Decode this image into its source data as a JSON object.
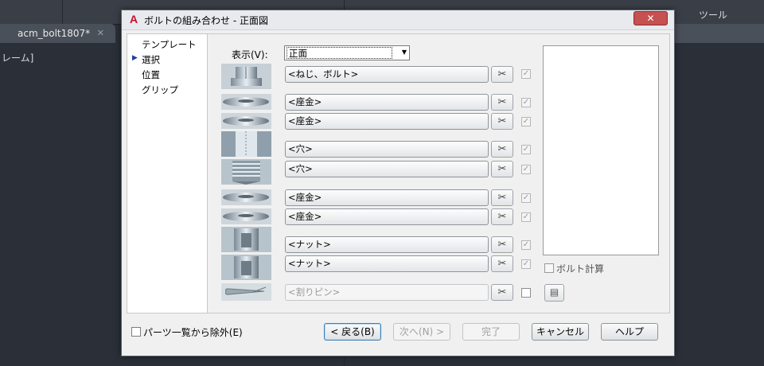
{
  "background_app": {
    "document_tab": "acm_bolt1807*",
    "tab_close": "✕",
    "left_fragment": "レーム]",
    "menu_fragment": "ツール"
  },
  "dialog": {
    "title": "ボルトの組み合わせ - 正面図",
    "logo_letter": "A",
    "close_glyph": "✕",
    "nav": {
      "items": [
        {
          "label": "テンプレート",
          "selected": false
        },
        {
          "label": "選択",
          "selected": true
        },
        {
          "label": "位置",
          "selected": false
        },
        {
          "label": "グリップ",
          "selected": false
        }
      ],
      "selected_marker": "▶"
    },
    "view": {
      "label": "表示(V):",
      "selected": "正面",
      "dropdown_arrow": "▼"
    },
    "rows": [
      {
        "label": "<ねじ、ボルト>",
        "part": "bolt-head",
        "checked": true,
        "enabled": true
      },
      {
        "label": "<座金>",
        "part": "washer",
        "checked": true,
        "enabled": true
      },
      {
        "label": "<座金>",
        "part": "washer",
        "checked": true,
        "enabled": true
      },
      {
        "label": "<穴>",
        "part": "hole",
        "checked": true,
        "enabled": true
      },
      {
        "label": "<穴>",
        "part": "threaded-hole",
        "checked": true,
        "enabled": true
      },
      {
        "label": "<座金>",
        "part": "washer",
        "checked": true,
        "enabled": true
      },
      {
        "label": "<座金>",
        "part": "washer",
        "checked": true,
        "enabled": true
      },
      {
        "label": "<ナット>",
        "part": "nut",
        "checked": true,
        "enabled": true
      },
      {
        "label": "<ナット>",
        "part": "nut",
        "checked": true,
        "enabled": true
      },
      {
        "label": "<割りピン>",
        "part": "split-pin",
        "checked": false,
        "enabled": false
      }
    ],
    "check_glyph": "✓",
    "pick_glyph": "✂",
    "calc_icon_glyph": "▤",
    "bolt_calc_label": "ボルト計算",
    "exclude_label": "パーツ一覧から除外(E)",
    "buttons": {
      "back": "< 戻る(B)",
      "next": "次へ(N) >",
      "finish": "完了",
      "cancel": "キャンセル",
      "help": "ヘルプ"
    }
  }
}
